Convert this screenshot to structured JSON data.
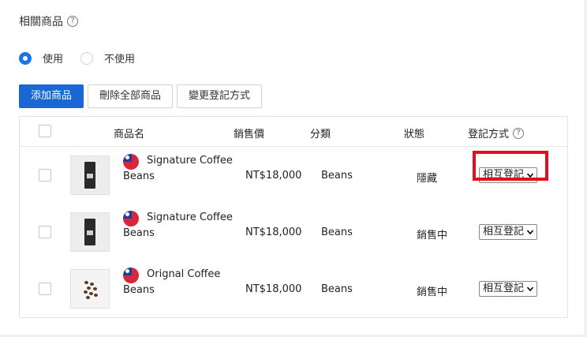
{
  "section": {
    "title": "相關商品",
    "help": "?"
  },
  "radio": {
    "options": [
      {
        "label": "使用",
        "checked": true
      },
      {
        "label": "不使用",
        "checked": false
      }
    ]
  },
  "buttons": {
    "add": "添加商品",
    "delete_all": "刪除全部商品",
    "change_method": "變更登記方式"
  },
  "table": {
    "headers": {
      "name": "商品名",
      "price": "銷售價",
      "category": "分類",
      "status": "狀態",
      "method": "登記方式",
      "method_help": "?"
    },
    "rows": [
      {
        "name_line1": "Signature Coffee",
        "name_line2": "Beans",
        "price": "NT$18,000",
        "category": "Beans",
        "status": "隱藏",
        "method": "相互登記",
        "thumb": "coffee-bag"
      },
      {
        "name_line1": "Signature Coffee",
        "name_line2": "Beans",
        "price": "NT$18,000",
        "category": "Beans",
        "status": "銷售中",
        "method": "相互登記",
        "thumb": "coffee-bag"
      },
      {
        "name_line1": "Orignal Coffee",
        "name_line2": "Beans",
        "price": "NT$18,000",
        "category": "Beans",
        "status": "銷售中",
        "method": "相互登記",
        "thumb": "coffee-beans"
      }
    ]
  },
  "colors": {
    "primary": "#1867d2",
    "highlight": "#e3101b"
  }
}
